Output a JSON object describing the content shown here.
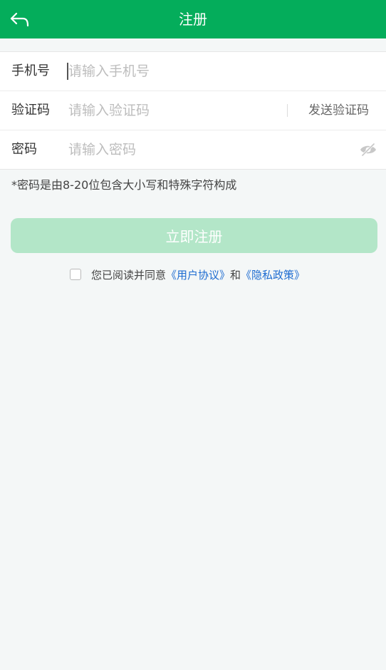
{
  "header": {
    "title": "注册",
    "back_icon": "back-arrow-icon"
  },
  "colors": {
    "header_bg": "#04ad5b",
    "button_disabled": "#b3e6c8",
    "link": "#1e6cd1",
    "page_bg": "#f4f7f7"
  },
  "form": {
    "phone": {
      "label": "手机号",
      "placeholder": "请输入手机号",
      "value": ""
    },
    "code": {
      "label": "验证码",
      "placeholder": "请输入验证码",
      "value": "",
      "send_label": "发送验证码"
    },
    "password": {
      "label": "密码",
      "placeholder": "请输入密码",
      "value": "",
      "visibility_icon": "eye-off-icon"
    }
  },
  "hint": "*密码是由8-20位包含大小写和特殊字符构成",
  "submit": {
    "label": "立即注册"
  },
  "agreement": {
    "checked": false,
    "prefix": "您已阅读并同意",
    "user_agreement": "《用户协议》",
    "conjunction": "和",
    "privacy_policy": "《隐私政策》"
  }
}
